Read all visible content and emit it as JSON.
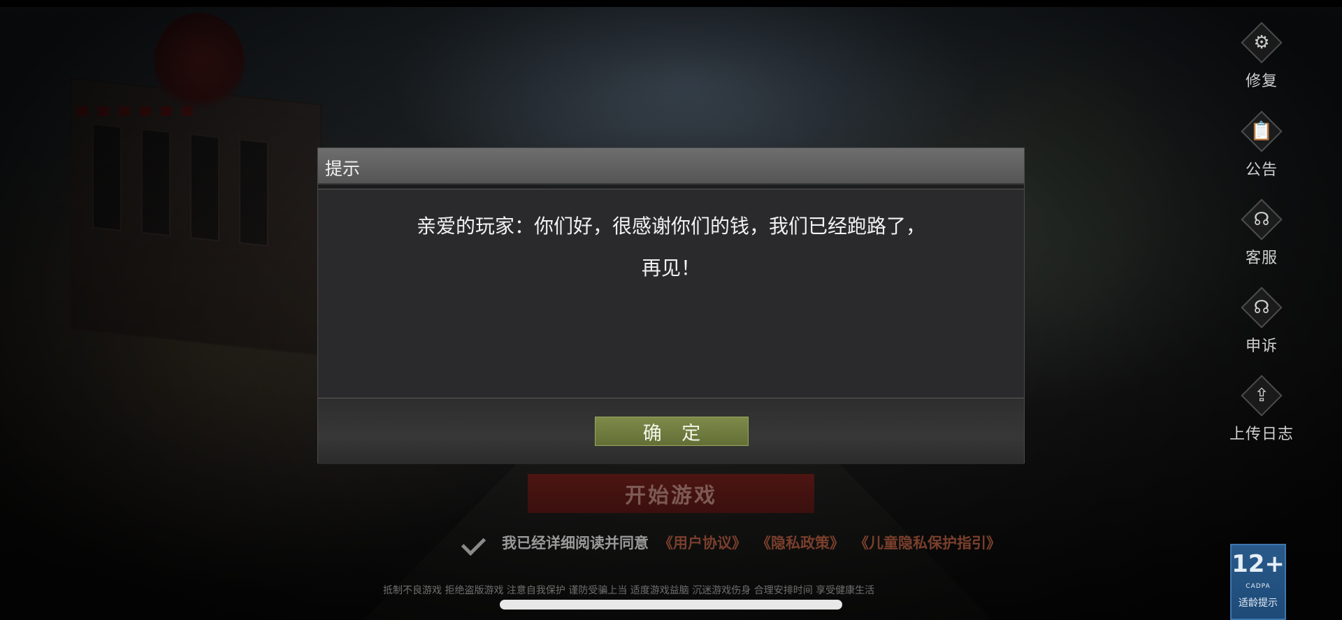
{
  "dialog": {
    "title": "提示",
    "message_line1": "亲爱的玩家：你们好，很感谢你们的钱，我们已经跑路了，",
    "message_line2": "再见！",
    "ok_label": "确 定"
  },
  "sidebar": {
    "items": [
      {
        "label": "修复",
        "icon": "gear-icon"
      },
      {
        "label": "公告",
        "icon": "notice-icon"
      },
      {
        "label": "客服",
        "icon": "headset-icon"
      },
      {
        "label": "申诉",
        "icon": "appeal-icon"
      },
      {
        "label": "上传日志",
        "icon": "upload-icon"
      }
    ]
  },
  "start_button": {
    "label": "开始游戏"
  },
  "agreement": {
    "text": "我已经详细阅读并同意",
    "links": [
      "《用户协议》",
      "《隐私政策》",
      "《儿童隐私保护指引》"
    ]
  },
  "health_notice": "抵制不良游戏 拒绝盗版游戏 注意自我保护 谨防受骗上当 适度游戏益脑 沉迷游戏伤身 合理安排时间 享受健康生活",
  "age_badge": {
    "rating": "12+",
    "org": "CADPA",
    "label": "适龄提示"
  },
  "colors": {
    "ok_button": "#6f7c3f",
    "start_button": "#4d1512",
    "link": "#7a3f2c",
    "age_badge": "#1d4a77"
  }
}
